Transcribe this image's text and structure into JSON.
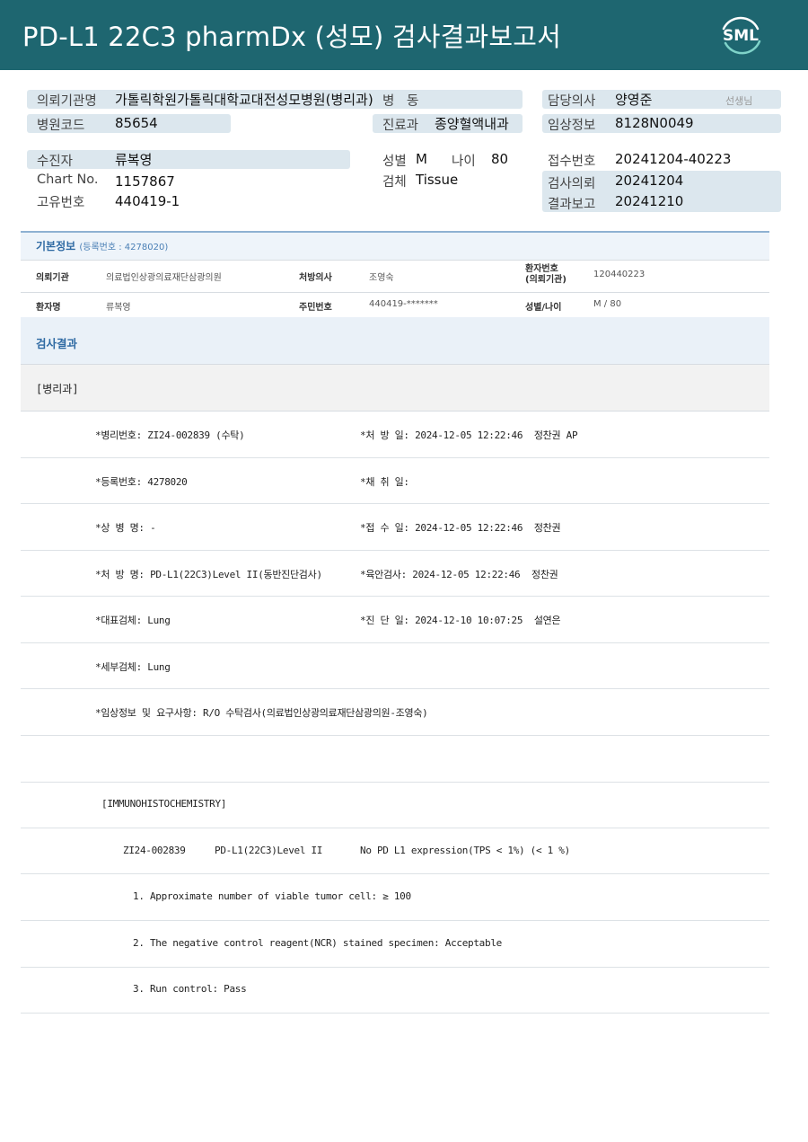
{
  "header": {
    "title": "PD-L1 22C3 pharmDx (성모) 검사결과보고서",
    "logo_text": "SML",
    "bg_color": "#1e6670"
  },
  "top_info": {
    "institution_label": "의뢰기관명",
    "institution_value": "가톨릭학원가톨릭대학교대전성모병원(병리과)",
    "ward_label": "병",
    "ward_suffix": "동",
    "doctor_label": "담당의사",
    "doctor_value": "양영준",
    "doctor_suffix": "선생님",
    "hospital_code_label": "병원코드",
    "hospital_code_value": "85654",
    "dept_label": "진료과",
    "dept_value": "종양혈액내과",
    "clinical_label": "임상정보",
    "clinical_value": "8128N0049",
    "patient_label": "수진자",
    "patient_value": "류복영",
    "sex_label": "성별",
    "sex_value": "M",
    "age_label": "나이",
    "age_value": "80",
    "receipt_label": "접수번호",
    "receipt_value": "20241204-40223",
    "chart_label": "Chart No.",
    "chart_value": "1157867",
    "specimen_label": "검체",
    "specimen_value": "Tissue",
    "request_label": "검사의뢰",
    "request_value": "20241204",
    "unique_label": "고유번호",
    "unique_value": "440419-1",
    "result_report_label": "결과보고",
    "result_report_value": "20241210"
  },
  "basic_info": {
    "title": "기본정보",
    "subtitle": "(등록번호 : 4278020)",
    "row1": {
      "k1": "의뢰기관",
      "v1": "의료법인상광의료재단삼광의원",
      "k2": "처방의사",
      "v2": "조영숙",
      "k3a": "환자번호",
      "k3b": "(의뢰기관)",
      "v3": "120440223"
    },
    "row2": {
      "k1": "환자명",
      "v1": "류복영",
      "k2": "주민번호",
      "v2": "440419-*******",
      "k3": "성별/나이",
      "v3": "M / 80"
    }
  },
  "results": {
    "title": "검사결과",
    "dept": "[병리과]",
    "lines": [
      {
        "left": "*병리번호: ZI24-002839 (수탁)",
        "right": "*처 방 일: 2024-12-05 12:22:46  정찬권 AP"
      },
      {
        "left": "*등록번호: 4278020",
        "right": "*채 취 일:"
      },
      {
        "left": "*상 병 명: -",
        "right": "*접 수 일: 2024-12-05 12:22:46  정찬권"
      },
      {
        "left": "*처 방 명: PD-L1(22C3)Level II(동반진단검사)",
        "right": "*육안검사: 2024-12-05 12:22:46  정찬권"
      },
      {
        "left": "*대표검체: Lung",
        "right": "*진 단 일: 2024-12-10 10:07:25  설연은"
      },
      {
        "left": "*세부검체: Lung",
        "right": ""
      },
      {
        "left": "*임상정보 및 요구사항: R/O 수탁검사(의료법인상광의료재단삼광의원-조영숙)",
        "right": ""
      }
    ],
    "ihc_header": "[IMMUNOHISTOCHEMISTRY]",
    "ihc_id": "ZI24-002839",
    "ihc_test": "PD-L1(22C3)Level II",
    "ihc_result": "No PD L1 expression(TPS < 1%) (< 1 %)",
    "notes": [
      "1. Approximate number of viable tumor cell: ≥ 100",
      "2. The negative control reagent(NCR) stained specimen: Acceptable",
      "3. Run control: Pass"
    ]
  }
}
